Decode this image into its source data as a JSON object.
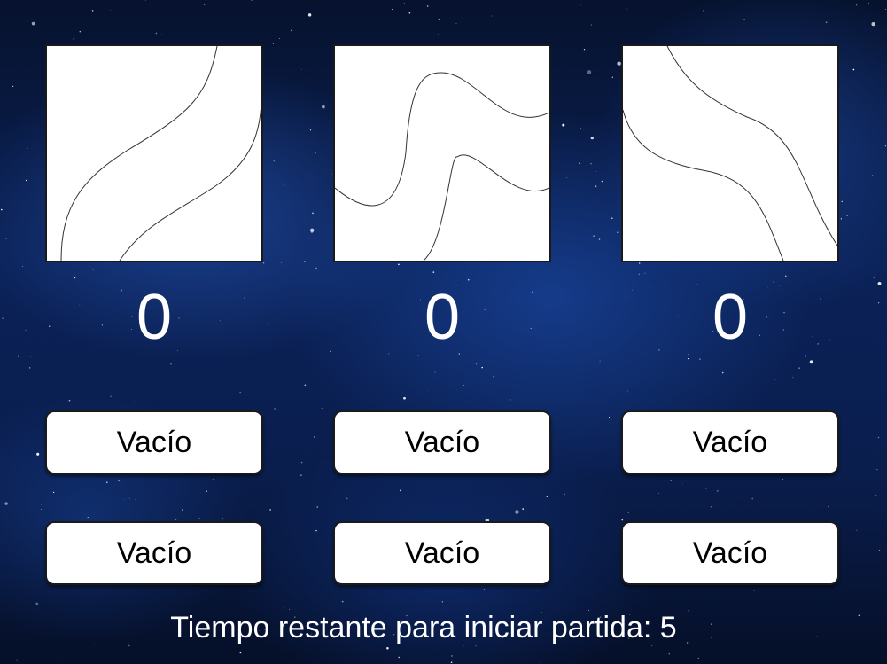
{
  "game": {
    "accent_colors": {
      "background": "#0b2258",
      "card": "#ffffff",
      "text": "#ffffff"
    },
    "cards": [
      {
        "curve": "two-rising-s-curves"
      },
      {
        "curve": "two-wavy-curves"
      },
      {
        "curve": "two-falling-s-curves"
      }
    ],
    "scores": [
      "0",
      "0",
      "0"
    ],
    "slots": [
      [
        "Vacío",
        "Vacío",
        "Vacío"
      ],
      [
        "Vacío",
        "Vacío",
        "Vacío"
      ]
    ],
    "countdown_label": "Tiempo restante para iniciar partida:",
    "countdown_value": "5"
  }
}
